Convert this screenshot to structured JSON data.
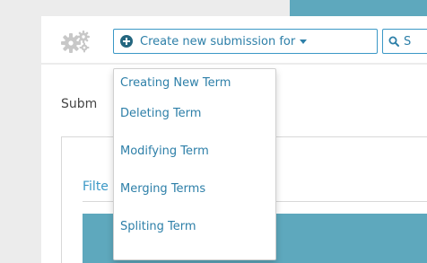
{
  "toolbar": {
    "create_label": "Create new submission for",
    "search_label": "S"
  },
  "create_menu": {
    "items": [
      {
        "label": "Creating New Term"
      },
      {
        "label": "Deleting Term"
      },
      {
        "label": "Modifying Term"
      },
      {
        "label": "Merging Terms"
      },
      {
        "label": "Spliting Term"
      }
    ]
  },
  "main": {
    "section_title": "Subm",
    "filter_title": "Filte"
  },
  "colors": {
    "accent": "#3b98c6",
    "text_link": "#2d7fa8",
    "header_bar": "#5ea8bd",
    "plus_icon_bg": "#24667f"
  },
  "icons": {
    "settings": "gears-icon",
    "create": "plus-circle-icon",
    "caret": "caret-down-icon",
    "search": "search-icon"
  }
}
